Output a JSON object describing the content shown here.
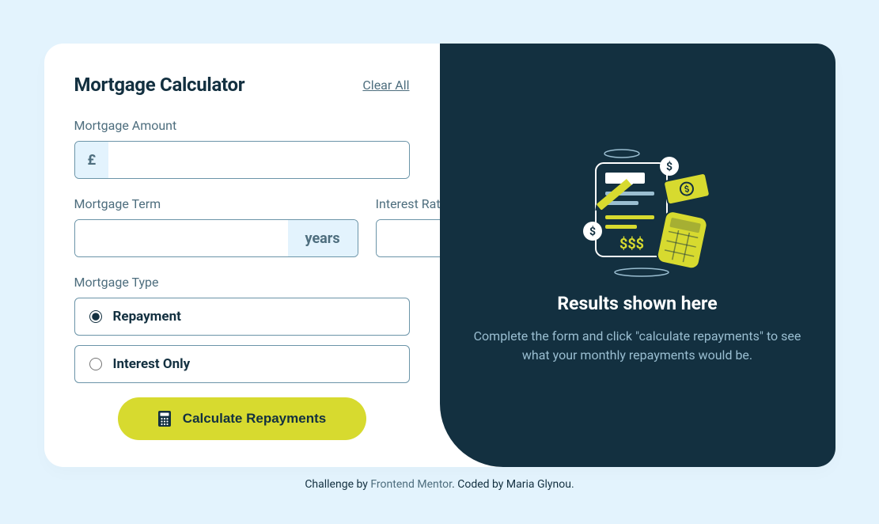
{
  "form": {
    "title": "Mortgage Calculator",
    "clear": "Clear All",
    "amount": {
      "label": "Mortgage Amount",
      "prefix": "£",
      "value": ""
    },
    "term": {
      "label": "Mortgage Term",
      "suffix": "years",
      "value": ""
    },
    "rate": {
      "label": "Interest Rate",
      "suffix": "%",
      "value": ""
    },
    "type": {
      "label": "Mortgage Type",
      "options": [
        "Repayment",
        "Interest Only"
      ],
      "selected": 0
    },
    "submit": "Calculate Repayments"
  },
  "results": {
    "title": "Results shown here",
    "description": "Complete the form and click \"calculate repayments\" to see what your monthly repayments would be."
  },
  "footer": {
    "prefix": "Challenge by ",
    "link": "Frontend Mentor",
    "suffix": ". Coded by Maria Glynou."
  }
}
